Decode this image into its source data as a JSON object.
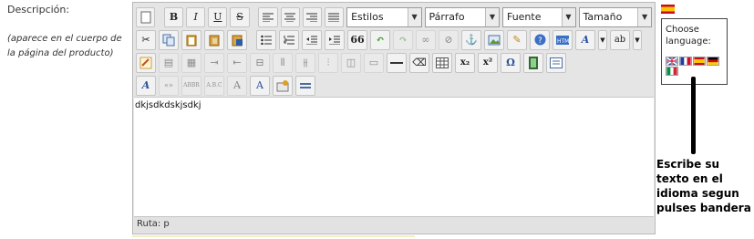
{
  "form": {
    "label": "Descripción:",
    "hint": "(aparece en el cuerpo de la página del producto)"
  },
  "editor": {
    "styles_combo": "Estilos",
    "format_combo": "Párrafo",
    "font_combo": "Fuente",
    "size_combo": "Tamaño",
    "content": "dkjsdkdskjsdkj",
    "status": "Ruta: p",
    "buttons": {
      "bold": "B",
      "italic": "I",
      "underline": "U",
      "strike": "S",
      "blockquote": "66",
      "subscript": "x₂",
      "superscript": "x²",
      "omega": "Ω"
    }
  },
  "language": {
    "title": "Choose language:",
    "flags": [
      "en-flag",
      "fr-flag",
      "es-flag",
      "de-flag",
      "it-flag"
    ]
  },
  "annotation": {
    "text": "Escribe su texto en el idioma segun pulses bandera"
  }
}
